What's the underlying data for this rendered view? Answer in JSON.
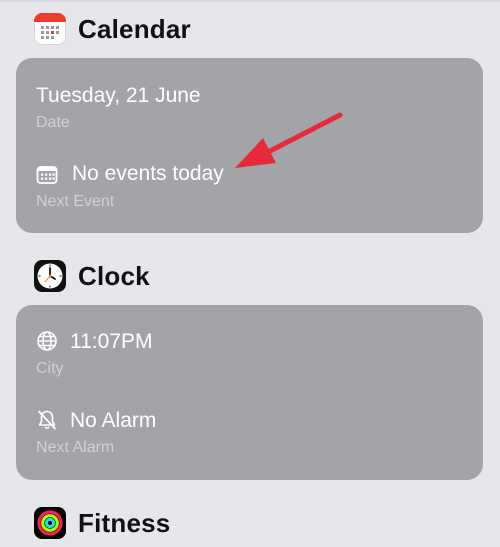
{
  "calendar": {
    "title": "Calendar",
    "icon": "calendar-app-icon",
    "date_value": "Tuesday, 21 June",
    "date_label": "Date",
    "event_value": "No events today",
    "event_label": "Next Event"
  },
  "clock": {
    "title": "Clock",
    "icon": "clock-app-icon",
    "time_value": "11:07PM",
    "time_label": "City",
    "alarm_value": "No Alarm",
    "alarm_label": "Next Alarm"
  },
  "fitness": {
    "title": "Fitness",
    "icon": "fitness-app-icon"
  },
  "annotation": {
    "color": "#e8293a",
    "icon": "pointer-arrow"
  },
  "colors": {
    "background": "#e6e7eb",
    "card": "#a3a4a8"
  }
}
